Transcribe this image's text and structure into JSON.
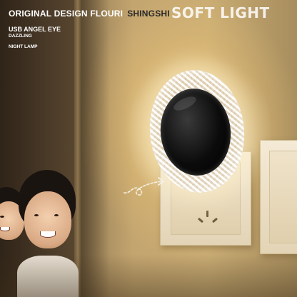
{
  "header": {
    "brand_primary": "ORIGINAL DESIGN FLOURI",
    "brand_secondary": "SHINGSHI",
    "product_line": "USB ANGEL EYE",
    "tag_1": "DAZZLING",
    "tag_2": "NIGHT LAMP"
  },
  "badge": {
    "text": "SOFT LIGHT"
  },
  "colors": {
    "wall_warm": "#c9ac74",
    "text_white": "#ffffff",
    "text_dark": "#2b2b2b"
  },
  "scene": {
    "objects": [
      "door-frame",
      "children",
      "outlet-panel",
      "night-lamp",
      "arrow-doodle"
    ]
  }
}
